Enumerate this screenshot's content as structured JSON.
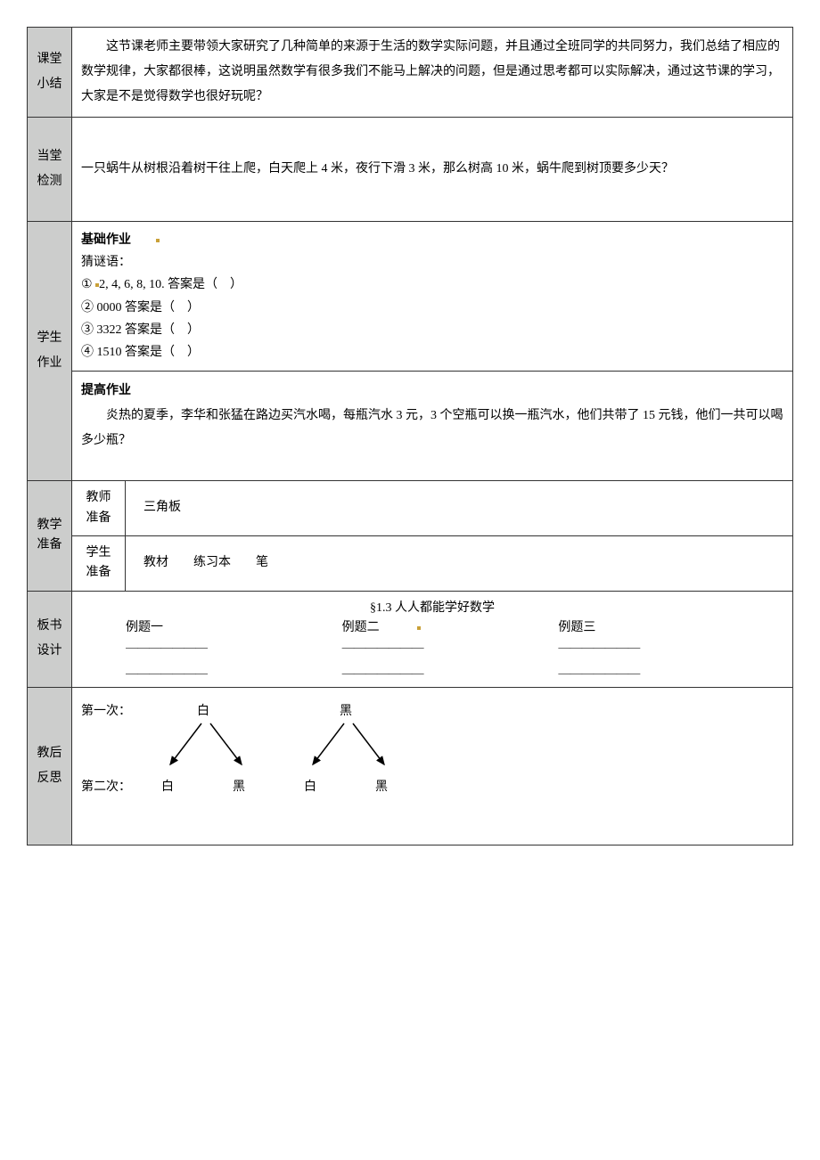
{
  "summary": {
    "label": "课堂小结",
    "text": "这节课老师主要带领大家研究了几种简单的来源于生活的数学实际问题，并且通过全班同学的共同努力，我们总结了相应的数学规律，大家都很棒，这说明虽然数学有很多我们不能马上解决的问题，但是通过思考都可以实际解决，通过这节课的学习，大家是不是觉得数学也很好玩呢？"
  },
  "quiz": {
    "label": "当堂检测",
    "text": "一只蜗牛从树根沿着树干往上爬，白天爬上 4 米，夜行下滑 3 米，那么树高 10 米，蜗牛爬到树顶要多少天？"
  },
  "homework": {
    "label": "学生作业",
    "basic": {
      "title": "基础作业",
      "riddle": "猜谜语：",
      "item1": "① ",
      "item1b": "2, 4, 6, 8, 10. 答案是（　）",
      "item2": "② 0000 答案是（　）",
      "item3": "③ 3322 答案是（　）",
      "item4": "④ 1510 答案是（　）"
    },
    "advanced": {
      "title": "提高作业",
      "text": "炎热的夏季，李华和张猛在路边买汽水喝，每瓶汽水 3 元，3 个空瓶可以换一瓶汽水，他们共带了 15 元钱，他们一共可以喝多少瓶？"
    }
  },
  "prep": {
    "label": "教学准备",
    "teacher_label": "教师准备",
    "teacher_value": "三角板",
    "student_label": "学生准备",
    "student_value": "教材　　练习本　　笔"
  },
  "board": {
    "label": "板书设计",
    "title": "§1.3 人人都能学好数学",
    "c1": "例题一",
    "c2": "例题二",
    "c3": "例题三",
    "line": "＿＿＿＿＿＿＿"
  },
  "reflect": {
    "label": "教后反思",
    "row1_label": "第一次：",
    "row2_label": "第二次：",
    "white": "白",
    "black": "黑"
  }
}
